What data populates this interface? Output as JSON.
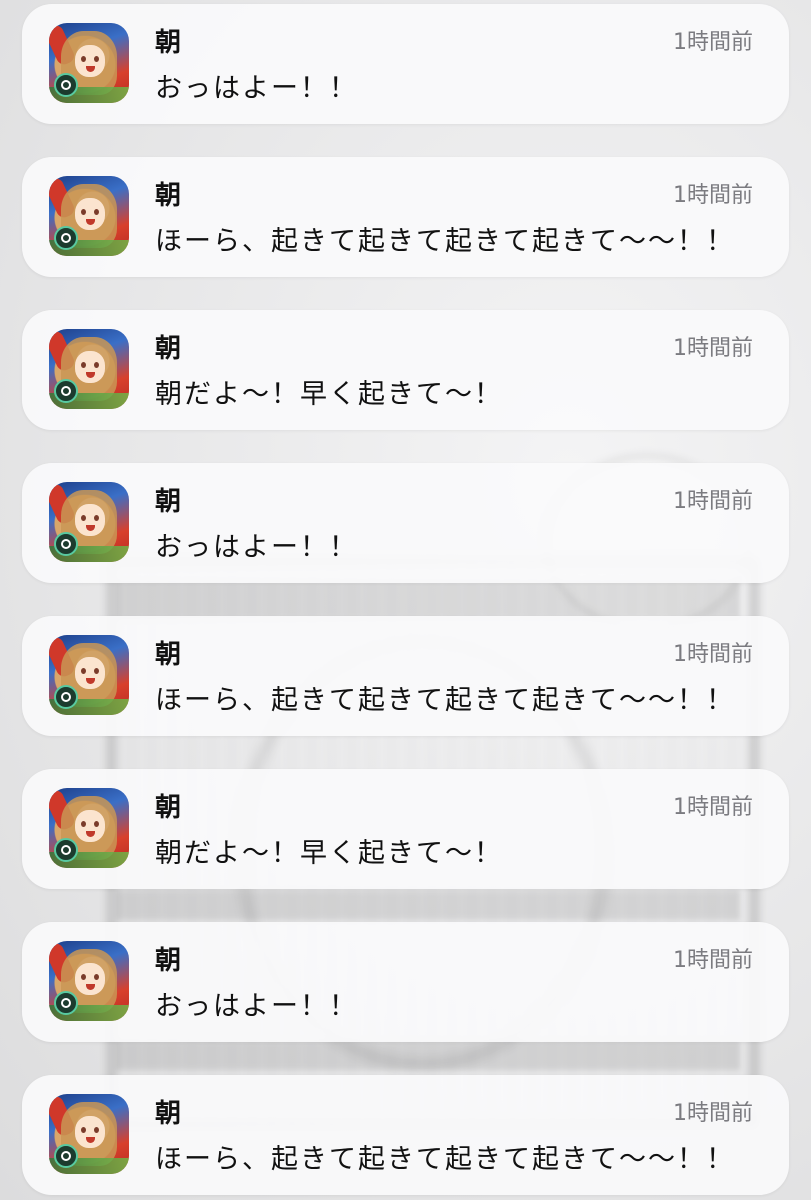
{
  "notifications": [
    {
      "app_icon": "app-icon-character",
      "title": "朝",
      "time": "1時間前",
      "body": "おっはよー！！"
    },
    {
      "app_icon": "app-icon-character",
      "title": "朝",
      "time": "1時間前",
      "body": "ほーら、起きて起きて起きて起きて〜〜！！"
    },
    {
      "app_icon": "app-icon-character",
      "title": "朝",
      "time": "1時間前",
      "body": "朝だよ〜！早く起きて〜！"
    },
    {
      "app_icon": "app-icon-character",
      "title": "朝",
      "time": "1時間前",
      "body": "おっはよー！！"
    },
    {
      "app_icon": "app-icon-character",
      "title": "朝",
      "time": "1時間前",
      "body": "ほーら、起きて起きて起きて起きて〜〜！！"
    },
    {
      "app_icon": "app-icon-character",
      "title": "朝",
      "time": "1時間前",
      "body": "朝だよ〜！早く起きて〜！"
    },
    {
      "app_icon": "app-icon-character",
      "title": "朝",
      "time": "1時間前",
      "body": "おっはよー！！"
    },
    {
      "app_icon": "app-icon-character",
      "title": "朝",
      "time": "1時間前",
      "body": "ほーら、起きて起きて起きて起きて〜〜！！"
    }
  ]
}
